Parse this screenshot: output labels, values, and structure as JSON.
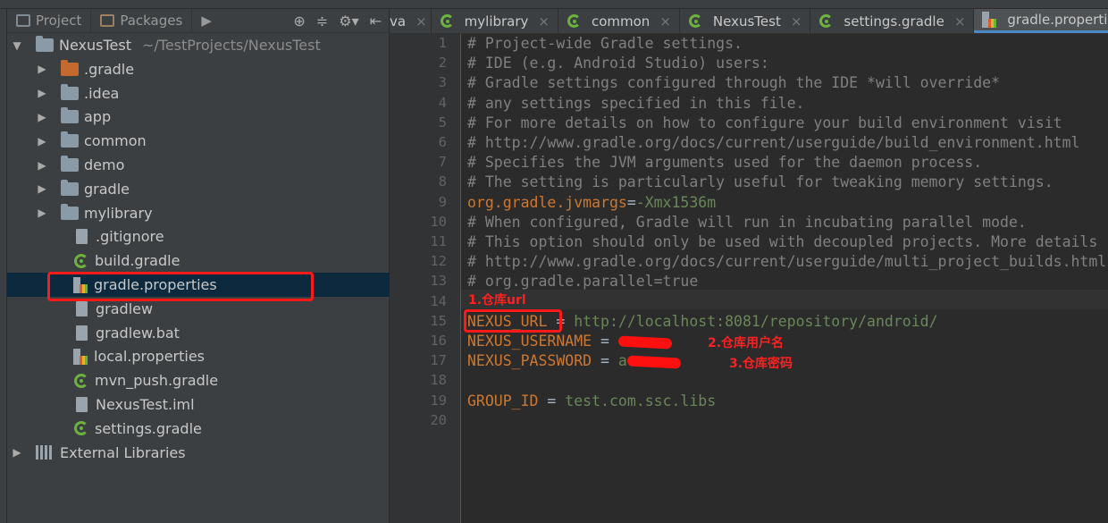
{
  "project_panel": {
    "tabs": [
      {
        "label": "Project"
      },
      {
        "label": "Packages"
      }
    ],
    "tree": [
      {
        "name": "NexusTest",
        "path": "~/TestProjects/NexusTest",
        "kind": "root"
      },
      {
        "name": ".gradle",
        "kind": "folder-orange"
      },
      {
        "name": ".idea",
        "kind": "folder"
      },
      {
        "name": "app",
        "kind": "folder"
      },
      {
        "name": "common",
        "kind": "module"
      },
      {
        "name": "demo",
        "kind": "folder"
      },
      {
        "name": "gradle",
        "kind": "folder"
      },
      {
        "name": "mylibrary",
        "kind": "module"
      },
      {
        "name": ".gitignore",
        "kind": "file"
      },
      {
        "name": "build.gradle",
        "kind": "gradle"
      },
      {
        "name": "gradle.properties",
        "kind": "properties",
        "selected": true
      },
      {
        "name": "gradlew",
        "kind": "file"
      },
      {
        "name": "gradlew.bat",
        "kind": "file"
      },
      {
        "name": "local.properties",
        "kind": "properties"
      },
      {
        "name": "mvn_push.gradle",
        "kind": "gradle"
      },
      {
        "name": "NexusTest.iml",
        "kind": "file"
      },
      {
        "name": "settings.gradle",
        "kind": "gradle"
      },
      {
        "name": "External Libraries",
        "kind": "libs"
      }
    ]
  },
  "editor_tabs": [
    {
      "label": "va",
      "icon": "none"
    },
    {
      "label": "mylibrary",
      "icon": "gradle-icon"
    },
    {
      "label": "common",
      "icon": "gradle-icon"
    },
    {
      "label": "NexusTest",
      "icon": "gradle-icon"
    },
    {
      "label": "settings.gradle",
      "icon": "gradle-icon"
    },
    {
      "label": "gradle.properties",
      "icon": "properties-icon",
      "active": true
    }
  ],
  "code_lines": [
    [
      {
        "t": "c",
        "s": "# Project-wide Gradle settings."
      }
    ],
    [
      {
        "t": "c",
        "s": "# IDE (e.g. Android Studio) users:"
      }
    ],
    [
      {
        "t": "c",
        "s": "# Gradle settings configured through the IDE *will override*"
      }
    ],
    [
      {
        "t": "c",
        "s": "# any settings specified in this file."
      }
    ],
    [
      {
        "t": "c",
        "s": "# For more details on how to configure your build environment visit"
      }
    ],
    [
      {
        "t": "c",
        "s": "# http://www.gradle.org/docs/current/userguide/build_environment.html"
      }
    ],
    [
      {
        "t": "c",
        "s": "# Specifies the JVM arguments used for the daemon process."
      }
    ],
    [
      {
        "t": "c",
        "s": "# The setting is particularly useful for tweaking memory settings."
      }
    ],
    [
      {
        "t": "k",
        "s": "org.gradle.jvmargs"
      },
      {
        "t": "eq",
        "s": "="
      },
      {
        "t": "v",
        "s": "-Xmx1536m"
      }
    ],
    [
      {
        "t": "c",
        "s": "# When configured, Gradle will run in incubating parallel mode."
      }
    ],
    [
      {
        "t": "c",
        "s": "# This option should only be used with decoupled projects. More details"
      }
    ],
    [
      {
        "t": "c",
        "s": "# http://www.gradle.org/docs/current/userguide/multi_project_builds.html"
      }
    ],
    [
      {
        "t": "c",
        "s": "# org.gradle.parallel=true"
      }
    ],
    [],
    [
      {
        "t": "k",
        "s": "NEXUS_URL"
      },
      {
        "t": "eq",
        "s": " = "
      },
      {
        "t": "v",
        "s": "http://localhost:8081/repository/android/"
      }
    ],
    [
      {
        "t": "k",
        "s": "NEXUS_USERNAME"
      },
      {
        "t": "eq",
        "s": " = "
      },
      {
        "t": "redact",
        "s": ""
      }
    ],
    [
      {
        "t": "k",
        "s": "NEXUS_PASSWORD"
      },
      {
        "t": "eq",
        "s": " = "
      },
      {
        "t": "v",
        "s": "a"
      },
      {
        "t": "redact",
        "s": ""
      }
    ],
    [],
    [
      {
        "t": "k",
        "s": "GROUP_ID"
      },
      {
        "t": "eq",
        "s": " = "
      },
      {
        "t": "v",
        "s": "test.com.ssc.libs"
      }
    ],
    []
  ],
  "annotations": {
    "url": "1.仓库url",
    "username": "2.仓库用户名",
    "password": "3.仓库密码"
  },
  "colors": {
    "highlight": "#ff1a1a",
    "selection": "#0d293e",
    "keyword": "#cc7832",
    "value": "#6a8759",
    "comment": "#808080"
  }
}
